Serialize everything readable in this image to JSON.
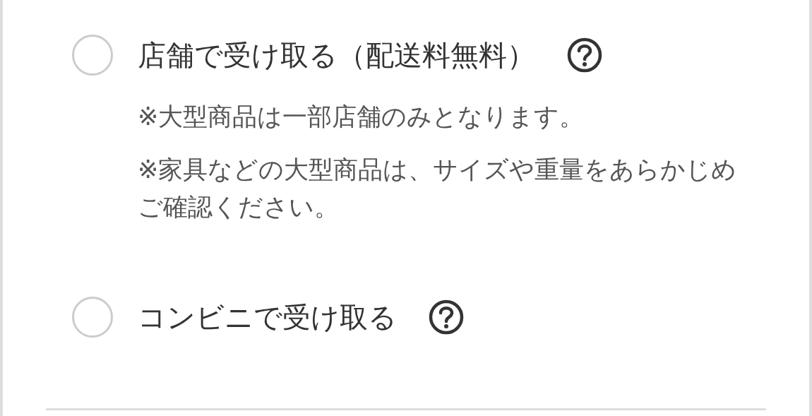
{
  "options": [
    {
      "label": "店舗で受け取る（配送料無料）",
      "selected": false,
      "notes": [
        "※大型商品は一部店舗のみとなります。",
        "※家具などの大型商品は、サイズや重量をあらかじめご確認ください。"
      ]
    },
    {
      "label": "コンビニで受け取る",
      "selected": false
    }
  ]
}
